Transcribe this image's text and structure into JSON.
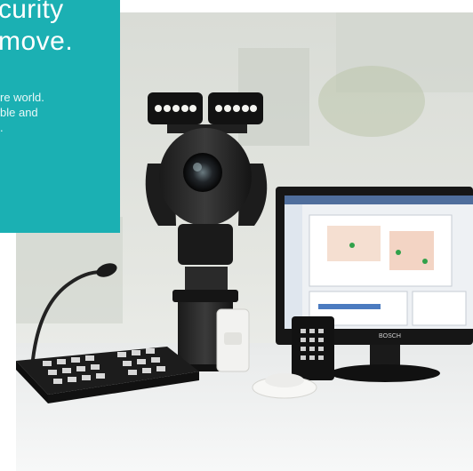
{
  "hero": {
    "headline_line1": "curity",
    "headline_line2": "move.",
    "body_lines": [
      "re world.",
      "ble and",
      "."
    ]
  },
  "colors": {
    "panel": "#1bb0b3",
    "background": "#ffffff"
  },
  "product_image": {
    "products": [
      "ptz-camera",
      "microphone-call-station",
      "monitor-software",
      "motion-detector",
      "keypad",
      "smoke-detector"
    ],
    "monitor_brand": "BOSCH"
  }
}
